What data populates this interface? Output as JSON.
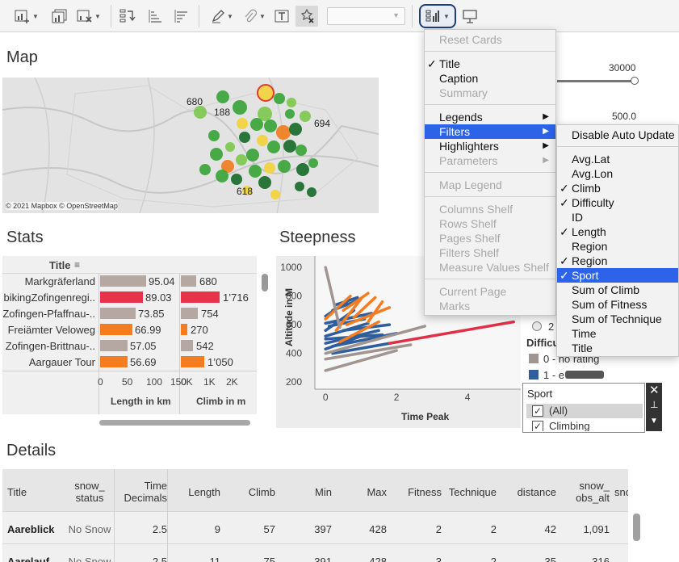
{
  "toolbar": {
    "icons": [
      "new-worksheet-icon",
      "duplicate-icon",
      "clear-sheet-icon",
      "swap-rows-columns-icon",
      "sort-ascending-icon",
      "sort-descending-icon",
      "highlight-pen-icon",
      "group-paperclip-icon",
      "show-labels-icon",
      "fix-axes-icon",
      "show-cards-icon",
      "presentation-mode-icon"
    ],
    "dropdown_value": ""
  },
  "map": {
    "title": "Map",
    "attribution": "© 2021 Mapbox © OpenStreetMap",
    "labels": [
      "680",
      "188",
      "694",
      "618"
    ],
    "colors": {
      "dark_green": "#1a6b2a",
      "green": "#3aa53a",
      "light_green": "#7ec850",
      "yellow": "#f2d23c",
      "orange": "#f07d1e",
      "red": "#e03a2a"
    }
  },
  "slider": {
    "max_value": "30000",
    "min_value": "500.0"
  },
  "stats": {
    "title": "Stats",
    "header": "Title",
    "rows": [
      {
        "title": "Markgräferland",
        "length": 95.04,
        "length_label": "95.04",
        "climb": 680,
        "climb_label": "680",
        "color": "#b5a8a2"
      },
      {
        "title": "bikingZofingenregi..",
        "length": 89.03,
        "length_label": "89.03",
        "climb": 1716,
        "climb_label": "1’716",
        "color": "#e8344a"
      },
      {
        "title": "Zofingen-Pfaffnau-..",
        "length": 73.85,
        "length_label": "73.85",
        "climb": 754,
        "climb_label": "754",
        "color": "#b5a8a2"
      },
      {
        "title": "Freiämter Veloweg",
        "length": 66.99,
        "length_label": "66.99",
        "climb": 270,
        "climb_label": "270",
        "color": "#f57c1f"
      },
      {
        "title": "Zofingen-Brittnau-..",
        "length": 57.05,
        "length_label": "57.05",
        "climb": 542,
        "climb_label": "542",
        "color": "#b5a8a2"
      },
      {
        "title": "Aargauer Tour",
        "length": 56.69,
        "length_label": "56.69",
        "climb": 1050,
        "climb_label": "1’050",
        "color": "#f57c1f"
      }
    ],
    "length_axis": {
      "label": "Length in km",
      "ticks": [
        "0",
        "50",
        "100",
        "150"
      ],
      "max": 150
    },
    "climb_axis": {
      "label": "Climb in m",
      "ticks": [
        "0K",
        "1K",
        "2K"
      ],
      "max": 2500
    }
  },
  "chart_data": {
    "type": "line",
    "title": "Steepness",
    "xlabel": "Time Peak",
    "ylabel": "Altitude in M",
    "xlim": [
      -0.3,
      5.5
    ],
    "ylim": [
      150,
      1080
    ],
    "x_ticks": [
      "0",
      "2",
      "4"
    ],
    "y_ticks": [
      "200",
      "400",
      "600",
      "800",
      "1000"
    ],
    "series": [
      {
        "color": "#2e5e9e",
        "segments": [
          [
            0,
            430,
            1.0,
            520
          ],
          [
            0,
            470,
            1.5,
            560
          ],
          [
            0,
            520,
            1.2,
            610
          ],
          [
            0,
            560,
            0.8,
            700
          ],
          [
            0,
            610,
            1.3,
            680
          ],
          [
            0.2,
            700,
            1.0,
            780
          ],
          [
            0.2,
            400,
            1.8,
            470
          ],
          [
            0,
            660,
            0.6,
            760
          ],
          [
            0.5,
            560,
            1.8,
            600
          ],
          [
            0.2,
            450,
            2.0,
            540
          ],
          [
            0.3,
            740,
            0.9,
            790
          ],
          [
            0,
            500,
            1.6,
            530
          ],
          [
            0.1,
            590,
            1.1,
            640
          ]
        ]
      },
      {
        "color": "#f57c1f",
        "segments": [
          [
            0.3,
            560,
            1.0,
            780
          ],
          [
            0.5,
            700,
            1.2,
            820
          ],
          [
            0.6,
            600,
            1.8,
            720
          ],
          [
            0.8,
            650,
            1.4,
            790
          ],
          [
            0,
            640,
            0.7,
            800
          ],
          [
            1.2,
            620,
            1.6,
            760
          ],
          [
            0.4,
            480,
            1.5,
            620
          ]
        ]
      },
      {
        "color": "#a09590",
        "segments": [
          [
            0,
            280,
            2.0,
            420
          ],
          [
            0,
            400,
            2.8,
            590
          ],
          [
            0,
            1000,
            0.4,
            580
          ],
          [
            0,
            360,
            2.4,
            460
          ]
        ]
      },
      {
        "color": "#e03046",
        "segments": [
          [
            1.8,
            470,
            5.3,
            620
          ]
        ]
      }
    ]
  },
  "legend": {
    "partial_radio": "2",
    "difficulty_title": "Difficu",
    "items": [
      {
        "label": "0 - no rating",
        "color": "#a09590"
      },
      {
        "label": "1 - e",
        "color": "#2e5e9e"
      }
    ]
  },
  "sport_filter": {
    "title": "Sport",
    "options": [
      {
        "label": "(All)",
        "checked": true
      },
      {
        "label": "Climbing",
        "checked": true
      }
    ]
  },
  "details": {
    "title": "Details",
    "headers": [
      "Title",
      "snow_\nstatus",
      "Time\nDecimals",
      "Length",
      "Climb",
      "Min",
      "Max",
      "Fitness",
      "Technique",
      "distance",
      "snow_\nobs_alt",
      "sno"
    ],
    "rows": [
      [
        "Aareblick",
        "No Snow",
        "2.5",
        "9",
        "57",
        "397",
        "428",
        "2",
        "2",
        "42",
        "1,091",
        ""
      ],
      [
        "Aarelauf",
        "No Snow",
        "2.5",
        "11",
        "75",
        "391",
        "428",
        "3",
        "2",
        "35",
        "316",
        ""
      ]
    ]
  },
  "cards_menu": {
    "items": [
      {
        "label": "Reset Cards",
        "disabled": true
      },
      {
        "sep": true
      },
      {
        "label": "Title",
        "checked": true
      },
      {
        "label": "Caption"
      },
      {
        "label": "Summary",
        "disabled": true
      },
      {
        "sep": true
      },
      {
        "label": "Legends",
        "sub": true
      },
      {
        "label": "Filters",
        "sub": true,
        "selected": true
      },
      {
        "label": "Highlighters",
        "sub": true
      },
      {
        "label": "Parameters",
        "sub": true,
        "disabled": true
      },
      {
        "sep": true
      },
      {
        "label": "Map Legend",
        "disabled": true
      },
      {
        "sep": true
      },
      {
        "label": "Columns Shelf",
        "disabled": true
      },
      {
        "label": "Rows Shelf",
        "disabled": true
      },
      {
        "label": "Pages Shelf",
        "disabled": true
      },
      {
        "label": "Filters Shelf",
        "disabled": true
      },
      {
        "label": "Measure Values Shelf",
        "disabled": true
      },
      {
        "sep": true
      },
      {
        "label": "Current Page",
        "disabled": true
      },
      {
        "label": "Marks",
        "disabled": true
      }
    ]
  },
  "filters_submenu": {
    "items": [
      {
        "label": "Disable Auto Update"
      },
      {
        "sep": true
      },
      {
        "label": "Avg.Lat"
      },
      {
        "label": "Avg.Lon"
      },
      {
        "label": "Climb",
        "checked": true
      },
      {
        "label": "Difficulty",
        "checked": true
      },
      {
        "label": "ID"
      },
      {
        "label": "Length",
        "checked": true
      },
      {
        "label": "Region"
      },
      {
        "label": "Region",
        "checked": true
      },
      {
        "label": "Sport",
        "checked": true,
        "selected": true
      },
      {
        "label": "Sum of Climb"
      },
      {
        "label": "Sum of Fitness"
      },
      {
        "label": "Sum of Technique"
      },
      {
        "label": "Time"
      },
      {
        "label": "Title"
      }
    ]
  }
}
